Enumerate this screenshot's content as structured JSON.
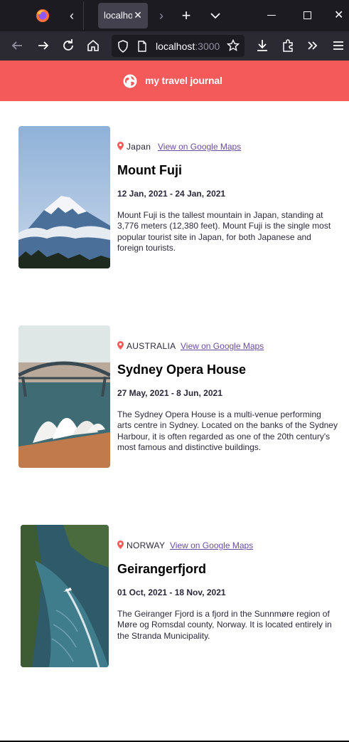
{
  "browser": {
    "tab_title": "localhost",
    "url_host": "localhost",
    "url_port": ":3000"
  },
  "app": {
    "title": "my travel journal",
    "accent": "#f55a5a"
  },
  "entries": [
    {
      "country": "Japan",
      "map_link": "View on Google Maps",
      "title": "Mount Fuji",
      "dates": "12 Jan, 2021 - 24 Jan, 2021",
      "description": "Mount Fuji is the tallest mountain in Japan, standing at 3,776 meters (12,380 feet). Mount Fuji is the single most popular tourist site in Japan, for both Japanese and foreign tourists."
    },
    {
      "country": "AUSTRALIA",
      "map_link": "View on Google Maps",
      "title": "Sydney Opera House",
      "dates": "27 May, 2021 - 8 Jun, 2021",
      "description": "The Sydney Opera House is a multi-venue performing arts centre in Sydney. Located on the banks of the Sydney Harbour, it is often regarded as one of the 20th century's most famous and distinctive buildings."
    },
    {
      "country": "NORWAY",
      "map_link": "View on Google Maps",
      "title": "Geirangerfjord",
      "dates": "01 Oct, 2021 - 18 Nov, 2021",
      "description": "The Geiranger Fjord is a fjord in the Sunnmøre region of Møre og Romsdal county, Norway. It is located entirely in the Stranda Municipality."
    }
  ]
}
